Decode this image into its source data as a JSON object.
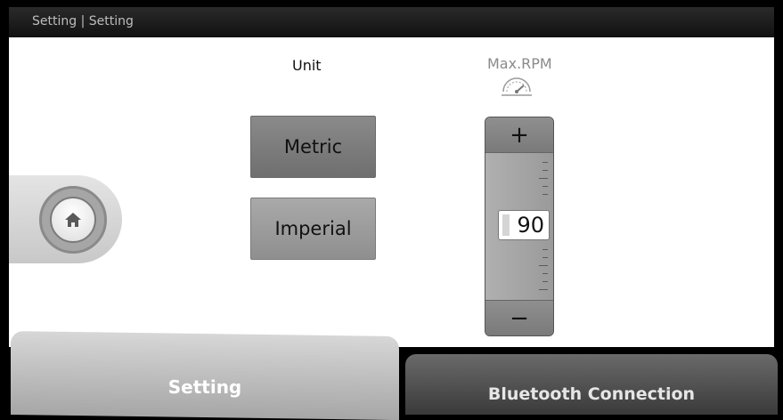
{
  "window": {
    "breadcrumb": "Setting | Setting"
  },
  "unit": {
    "title": "Unit",
    "options": [
      "Metric",
      "Imperial"
    ],
    "selected": "Metric"
  },
  "max_rpm": {
    "title": "Max.RPM",
    "value": "90",
    "increment_label": "+",
    "decrement_label": "−",
    "icon": "speedometer-icon"
  },
  "home": {
    "icon": "home-icon"
  },
  "tabs": [
    {
      "label": "Setting",
      "active": true
    },
    {
      "label": "Bluetooth Connection",
      "active": false
    }
  ]
}
